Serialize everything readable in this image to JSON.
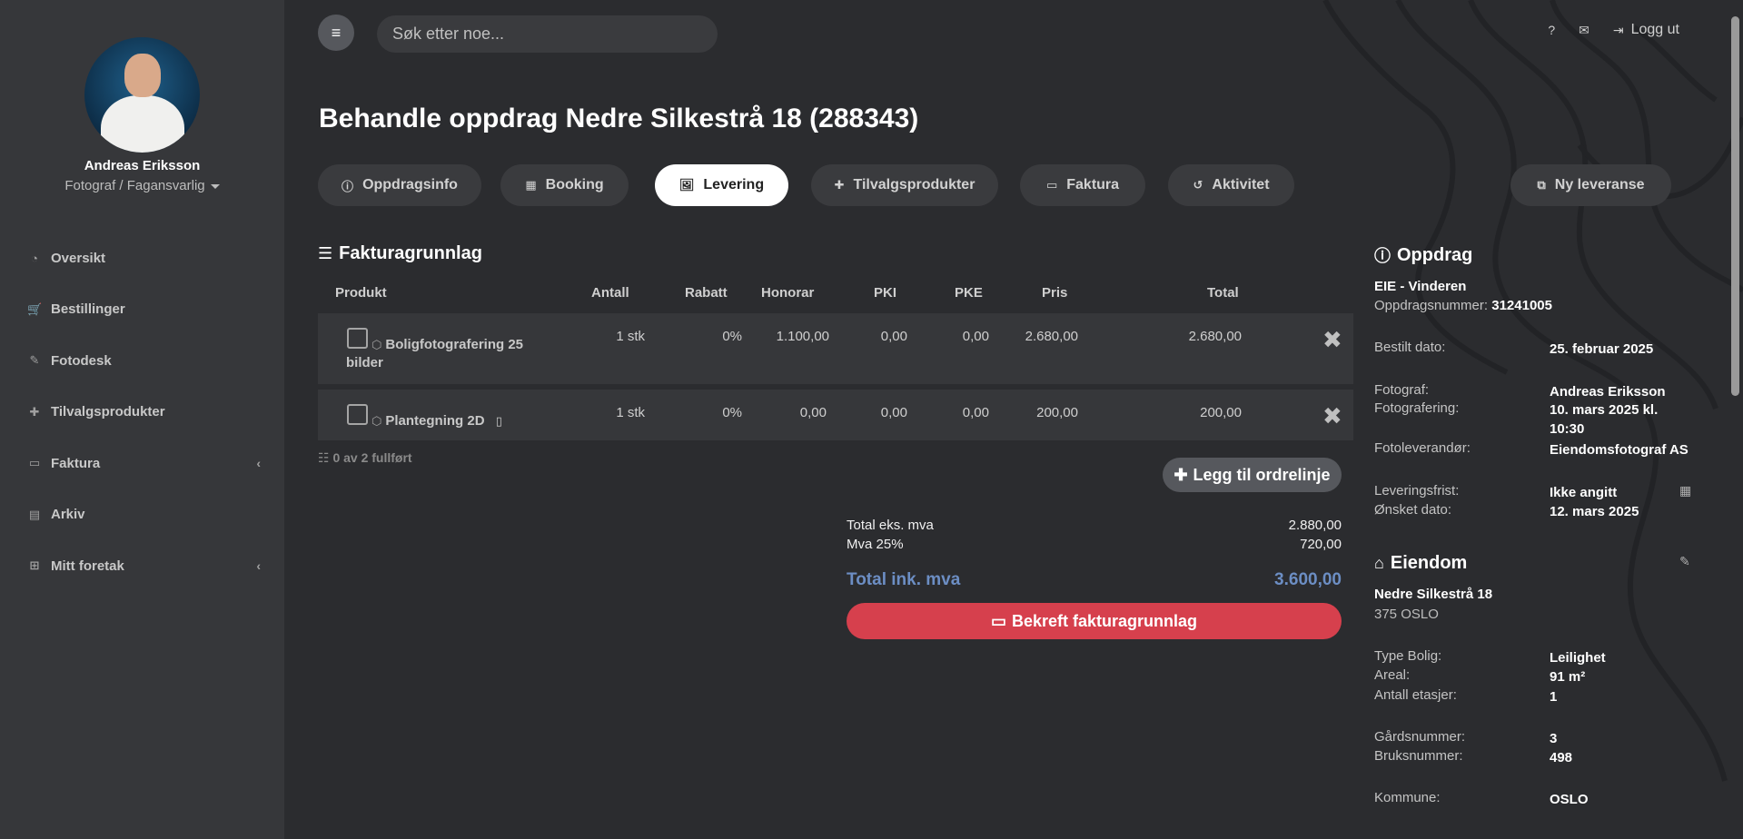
{
  "user": {
    "name": "Andreas Eriksson",
    "role": "Fotograf / Fagansvarlig"
  },
  "nav": [
    {
      "label": "Oversikt",
      "icon": "dashboard-icon",
      "glyph": "◔",
      "chev": ""
    },
    {
      "label": "Bestillinger",
      "icon": "cart-icon",
      "glyph": "🛒",
      "chev": ""
    },
    {
      "label": "Fotodesk",
      "icon": "brush-icon",
      "glyph": "✎",
      "chev": ""
    },
    {
      "label": "Tilvalgsprodukter",
      "icon": "plus-icon",
      "glyph": "✚",
      "chev": ""
    },
    {
      "label": "Faktura",
      "icon": "credit-card-icon",
      "glyph": "▭",
      "chev": "‹"
    },
    {
      "label": "Arkiv",
      "icon": "archive-icon",
      "glyph": "▤",
      "chev": ""
    },
    {
      "label": "Mitt foretak",
      "icon": "sitemap-icon",
      "glyph": "⊞",
      "chev": "‹"
    }
  ],
  "topbar": {
    "search_placeholder": "Søk etter noe...",
    "help_glyph": "?",
    "mail_glyph": "✉",
    "logout_label": "Logg ut",
    "logout_glyph": "⇥"
  },
  "page_title": "Behandle oppdrag Nedre Silkestrå 18 (288343)",
  "tabs": [
    {
      "label": "Oppdragsinfo",
      "glyph": "ⓘ",
      "active": false
    },
    {
      "label": "Booking",
      "glyph": "▦",
      "active": false
    },
    {
      "label": "Levering",
      "glyph": "🖼",
      "active": true
    },
    {
      "label": "Tilvalgsprodukter",
      "glyph": "✚",
      "active": false
    },
    {
      "label": "Faktura",
      "glyph": "▭",
      "active": false
    },
    {
      "label": "Aktivitet",
      "glyph": "↺",
      "active": false
    },
    {
      "label": "Ny leveranse",
      "glyph": "⧉",
      "active": false
    }
  ],
  "invoice": {
    "title": "Fakturagrunnlag",
    "title_glyph": "☰",
    "columns": [
      "Produkt",
      "Antall",
      "Rabatt",
      "Honorar",
      "PKI",
      "PKE",
      "Pris",
      "Total"
    ],
    "rows": [
      {
        "product_line1": "Boligfotografering 25",
        "product_line2": "bilder",
        "qty": "1 stk",
        "discount": "0%",
        "fee": "1.100,00",
        "pki": "0,00",
        "pke": "0,00",
        "price": "2.680,00",
        "total": "2.680,00",
        "extra_glyph": ""
      },
      {
        "product_line1": "Plantegning 2D",
        "product_line2": "",
        "qty": "1 stk",
        "discount": "0%",
        "fee": "0,00",
        "pki": "0,00",
        "pke": "0,00",
        "price": "200,00",
        "total": "200,00",
        "extra_glyph": "▯"
      }
    ],
    "product_glyph": "⬡",
    "delete_glyph": "✖",
    "completed": "0 av 2 fullført",
    "completed_glyph": "☷",
    "add_line_label": "Legg til ordrelinje",
    "add_glyph": "✚",
    "total_ex_label": "Total eks. mva",
    "total_ex_value": "2.880,00",
    "vat_label": "Mva 25%",
    "vat_value": "720,00",
    "total_inc_label": "Total ink. mva",
    "total_inc_value": "3.600,00",
    "confirm_label": "Bekreft fakturagrunnlag",
    "confirm_glyph": "▭"
  },
  "assignment": {
    "title": "Oppdrag",
    "title_glyph": "ⓘ",
    "client": "EIE - Vinderen",
    "number_label": "Oppdragsnummer:",
    "number_value": "31241005",
    "ordered_label": "Bestilt dato:",
    "ordered_value": "25. februar 2025",
    "photographer_label": "Fotograf:",
    "photographer_value": "Andreas Eriksson",
    "shoot_label": "Fotografering:",
    "shoot_value": "10. mars 2025 kl. 10:30",
    "supplier_label": "Fotoleverandør:",
    "supplier_value": "Eiendomsfotograf AS",
    "deadline_label": "Leveringsfrist:",
    "deadline_value": "Ikke angitt",
    "calendar_glyph": "▦",
    "wish_label": "Ønsket dato:",
    "wish_value": "12. mars 2025"
  },
  "property": {
    "title": "Eiendom",
    "title_glyph": "⌂",
    "edit_glyph": "✎",
    "address": "Nedre Silkestrå 18",
    "postal": "375 OSLO",
    "type_label": "Type Bolig:",
    "type_value": "Leilighet",
    "area_label": "Areal:",
    "area_value": "91 m²",
    "floors_label": "Antall etasjer:",
    "floors_value": "1",
    "gnr_label": "Gårdsnummer:",
    "gnr_value": "3",
    "bnr_label": "Bruksnummer:",
    "bnr_value": "498",
    "municipality_label": "Kommune:",
    "municipality_value": "OSLO"
  }
}
